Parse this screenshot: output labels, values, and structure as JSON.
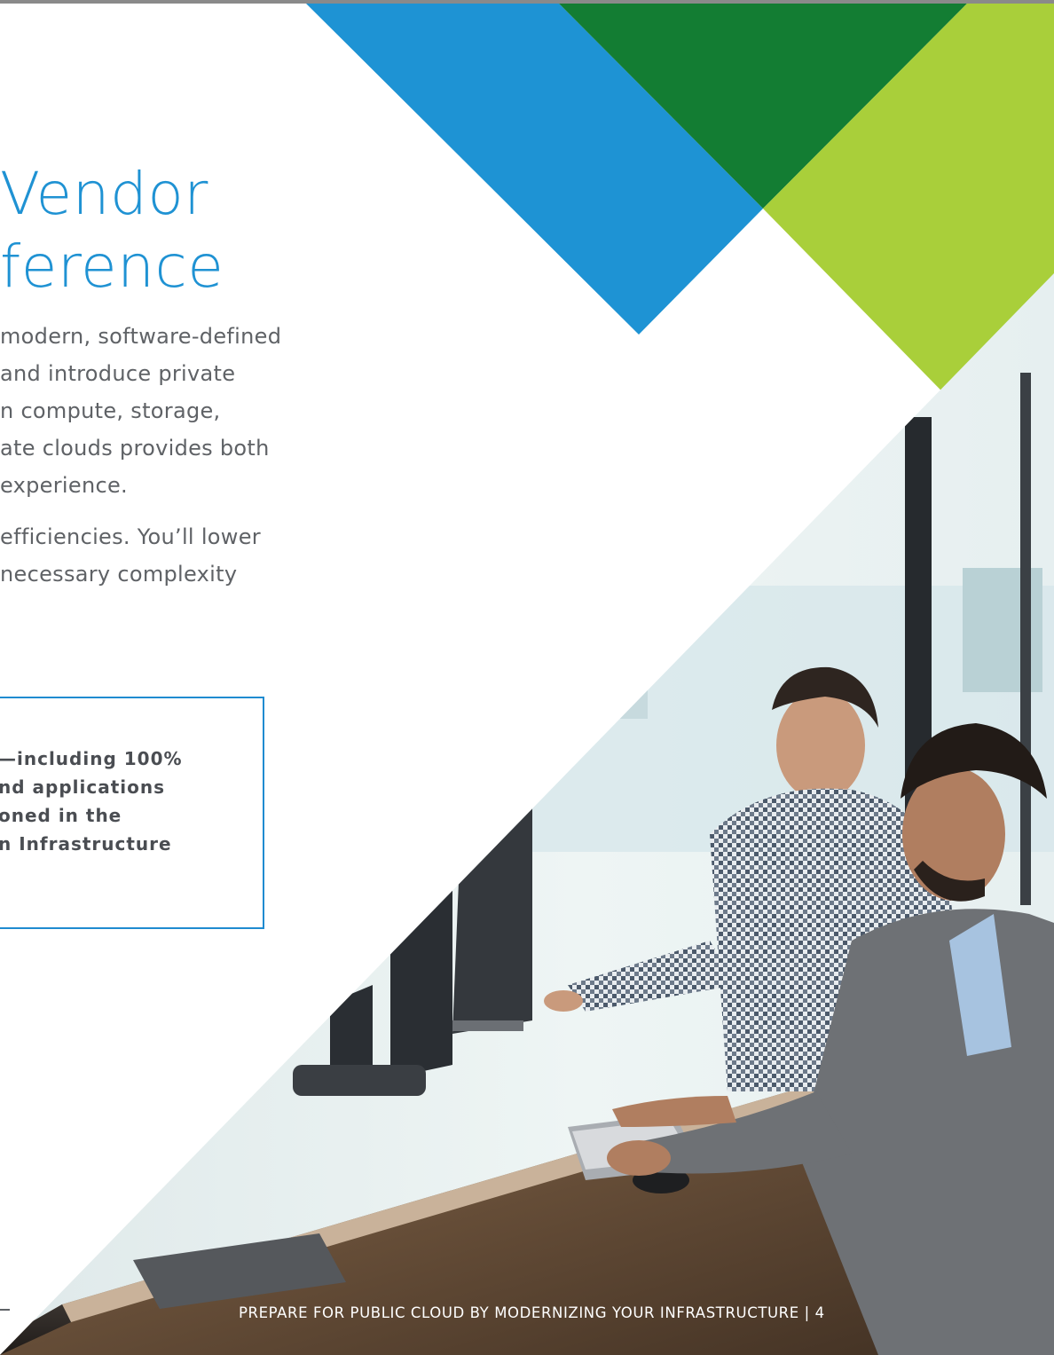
{
  "heading": {
    "line1": "Vendor",
    "line2": "ference"
  },
  "body": {
    "lines": [
      "modern, software-defined",
      "and introduce private",
      "n compute, storage,",
      "ate clouds provides both",
      "experience.",
      "efficiencies. You’ll lower",
      "necessary complexity"
    ]
  },
  "callout": {
    "lines": [
      "—including 100%",
      "nd applications",
      "oned in the",
      "n Infrastructure"
    ]
  },
  "footer": {
    "text": "PREPARE FOR PUBLIC CLOUD BY MODERNIZING YOUR INFRASTRUCTURE | 4"
  },
  "colors": {
    "accent_blue": "#1f92d3",
    "dark_green": "#137d33",
    "lime_green": "#a9cf3a",
    "body_gray": "#5f6266"
  },
  "photo": {
    "subject": "two-men-working-at-computers"
  }
}
